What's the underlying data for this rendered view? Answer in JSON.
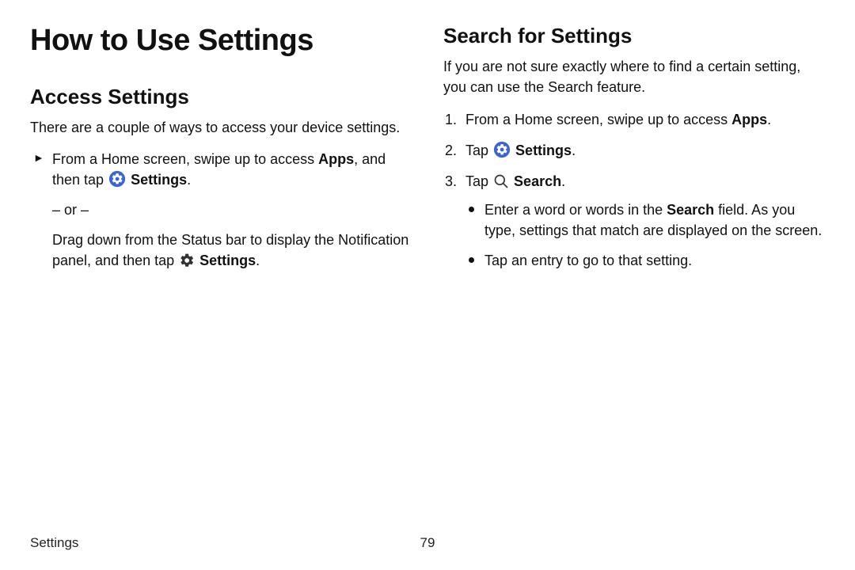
{
  "page": {
    "title": "How to Use Settings",
    "footer_label": "Settings",
    "page_number": "79"
  },
  "left": {
    "heading": "Access Settings",
    "intro": "There are a couple of ways to access your device settings.",
    "step_part_a": "From a Home screen, swipe up to access ",
    "apps_bold": "Apps",
    "step_part_b": ", and then tap ",
    "settings_bold": "Settings",
    "or": "– or –",
    "step_alt_a": "Drag down from the Status bar to display the Notification panel, and then tap ",
    "settings_bold2": "Settings"
  },
  "right": {
    "heading": "Search for Settings",
    "intro": "If you are not sure exactly where to find a certain setting, you can use the Search feature.",
    "s1_a": "From a Home screen, swipe up to access ",
    "s1_apps": "Apps",
    "s2_tap": "Tap ",
    "s2_settings": "Settings",
    "s3_tap": "Tap ",
    "s3_search": "Search",
    "b1_a": "Enter a word or words in the ",
    "b1_search": "Search",
    "b1_b": " field. As you type, settings that match are displayed on the screen.",
    "b2": "Tap an entry to go to that setting."
  }
}
